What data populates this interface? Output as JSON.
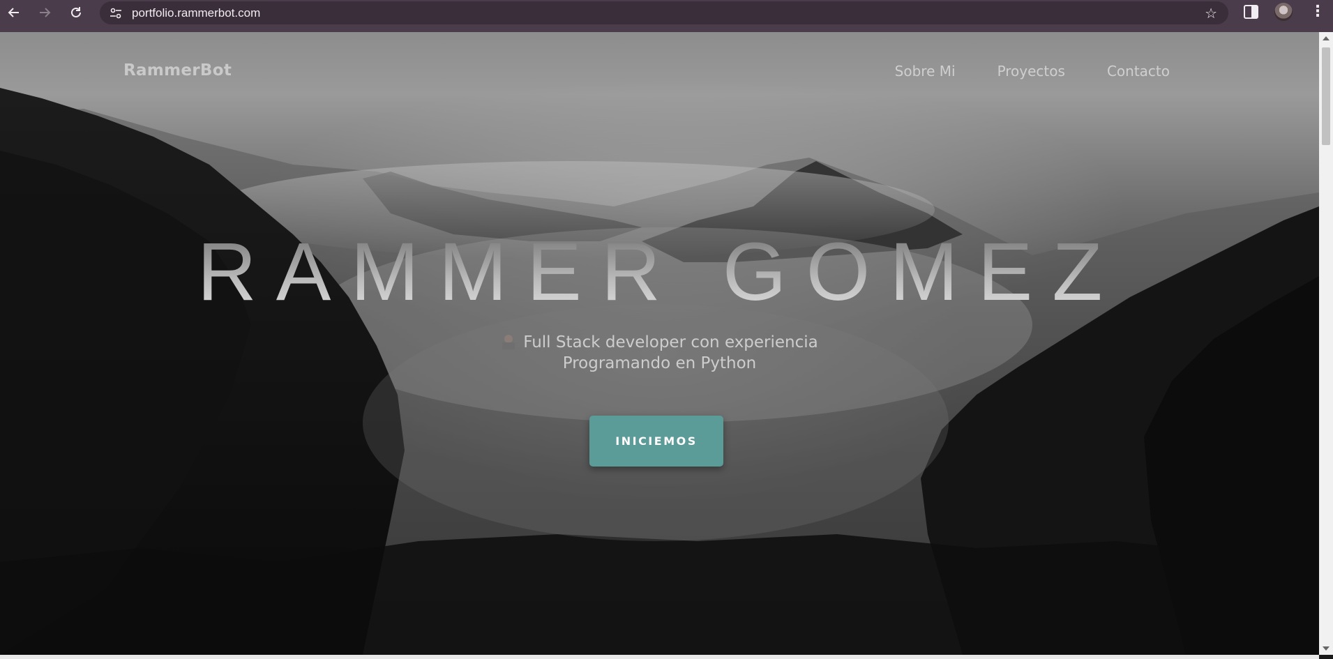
{
  "browser": {
    "url": "portfolio.rammerbot.com",
    "icons": {
      "back": "arrow-left-icon",
      "forward": "arrow-right-icon",
      "reload": "reload-icon",
      "site_info": "tune-icon",
      "bookmark": "star-icon",
      "side_panel": "side-panel-icon",
      "profile": "avatar",
      "menu": "kebab-menu-icon"
    }
  },
  "page": {
    "brand": "RammerBot",
    "nav": [
      "Sobre Mi",
      "Proyectos",
      "Contacto"
    ],
    "hero": {
      "title": "RAMMER GOMEZ",
      "subtitle_line1": "Full Stack developer con experiencia",
      "subtitle_line2": "Programando en Python",
      "subtitle_icon": "developer-emoji-icon",
      "cta_label": "INICIEMOS"
    },
    "colors": {
      "browser_bar": "#4a3c4a",
      "cta_background": "#5c9c98"
    }
  }
}
